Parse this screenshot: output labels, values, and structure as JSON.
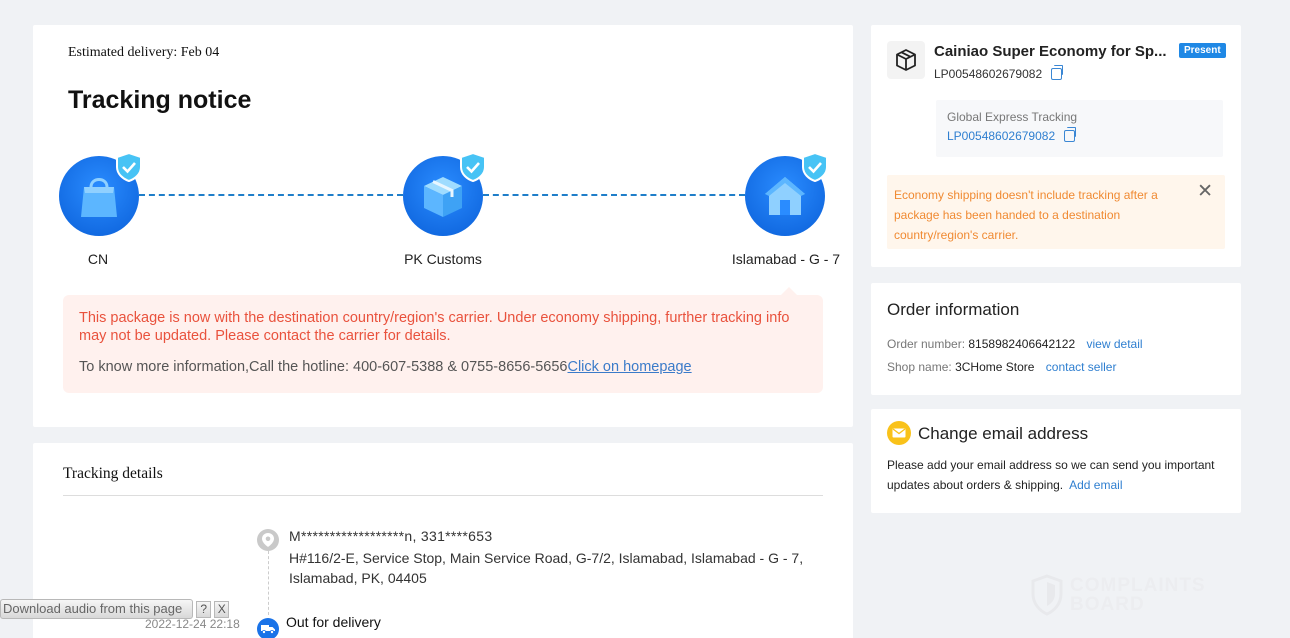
{
  "notice": {
    "estimated": "Estimated delivery: Feb 04",
    "title": "Tracking notice",
    "steps": [
      {
        "label": "CN"
      },
      {
        "label": "PK Customs"
      },
      {
        "label": "Islamabad - G - 7"
      }
    ],
    "alert_warning": "This package is now with the destination country/region's carrier. Under economy shipping, further tracking info may not be updated. Please contact the carrier for details.",
    "alert_info": "To know more information,Call the hotline: 400-607-5388 & 0755-8656-5656",
    "alert_link": "Click on homepage"
  },
  "details": {
    "title": "Tracking details",
    "recipient": "M******************n,  331****653",
    "address": "H#116/2-E, Service Stop, Main Service Road, G-7/2, Islamabad,  Islamabad - G - 7,  Islamabad,  PK,  04405",
    "event_title": "Out for delivery",
    "event_time": "2022-12-24 22:18"
  },
  "carrier": {
    "name": "Cainiao Super Economy for Sp...",
    "badge": "Present",
    "tracking_number": "LP00548602679082",
    "global_label": "Global Express Tracking",
    "global_number": "LP00548602679082",
    "economy_note": "Economy shipping doesn't include tracking after a package has been handed to a destination country/region's carrier.",
    "close_symbol": "✕"
  },
  "order": {
    "title": "Order information",
    "number_label": "Order number:",
    "number_value": "8158982406642122",
    "view_detail": "view detail",
    "shop_label": "Shop name:",
    "shop_value": "3CHome Store",
    "contact_seller": "contact seller"
  },
  "email": {
    "title": "Change email address",
    "text": "Please add your email address so we can send you important updates about orders & shipping.",
    "link": "Add email"
  },
  "overlay": {
    "audio_button": "Download audio from this page",
    "help": "?",
    "close": "X",
    "watermark_line1": "COMPLAINTS",
    "watermark_line2": "BOARD"
  },
  "colors": {
    "accent_blue": "#1f88e5",
    "warning_red": "#e9523d",
    "warning_orange": "#f08a32",
    "link_blue": "#2f7fd0"
  },
  "icons": [
    "shopping-bag-icon",
    "package-icon",
    "house-icon",
    "verified-shield-icon",
    "location-pin-icon",
    "truck-icon",
    "box-icon",
    "copy-icon",
    "close-icon",
    "mail-icon"
  ]
}
